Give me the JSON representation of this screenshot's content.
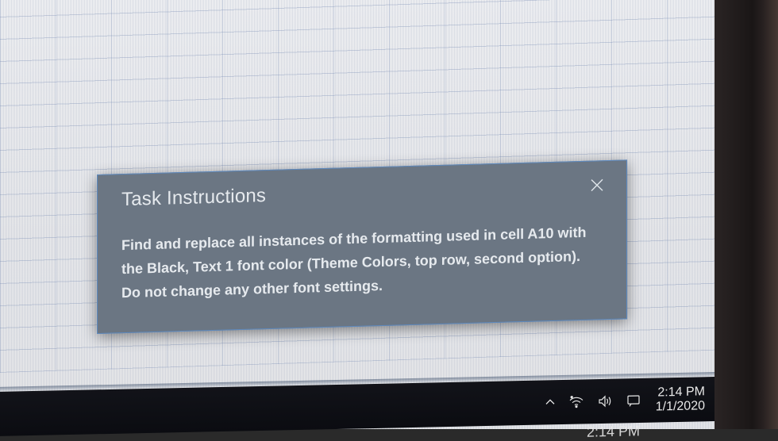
{
  "dialog": {
    "title": "Task Instructions",
    "body": "Find and replace all instances of the formatting used in cell A10 with the Black, Text 1 font color (Theme Colors, top row, second option). Do not change any other font settings."
  },
  "taskbar": {
    "time": "2:14 PM",
    "date": "1/1/2020",
    "ghost_time": "2:14 PM"
  }
}
